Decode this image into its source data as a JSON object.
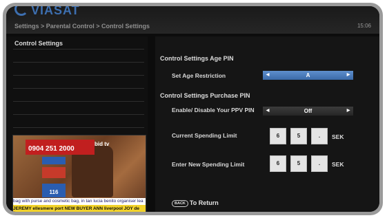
{
  "header": {
    "logo_text": "VIASAT",
    "breadcrumb": "Settings > Parental Control > Control Settings",
    "time": "15:06"
  },
  "sidebar": {
    "title": "Control Settings"
  },
  "preview": {
    "phone_number": "0904 251 2000",
    "channel_logo": "bid tv",
    "quantity": "116",
    "ticker_top": "bag with purse and cosmetic bag, in tan     lucia benito organiser lea",
    "ticker_bottom": "JEREMY  ellesmere port  NEW BUYER  ANN  liverpool  JOY  de"
  },
  "age_pin": {
    "section_title": "Control Settings Age PIN",
    "restriction_label": "Set Age Restriction",
    "restriction_value": "A"
  },
  "purchase_pin": {
    "section_title": "Control Settings Purchase PIN",
    "enable_label": "Enable/ Disable Your PPV PIN",
    "enable_value": "Off",
    "current_limit_label": "Current Spending Limit",
    "current_limit_digits": [
      "6",
      "5",
      "."
    ],
    "current_limit_unit": "SEK",
    "new_limit_label": "Enter New Spending Limit",
    "new_limit_digits": [
      "6",
      "5",
      "."
    ],
    "new_limit_unit": "SEK"
  },
  "footer": {
    "back_key": "BACK",
    "return_label": "To Return"
  }
}
